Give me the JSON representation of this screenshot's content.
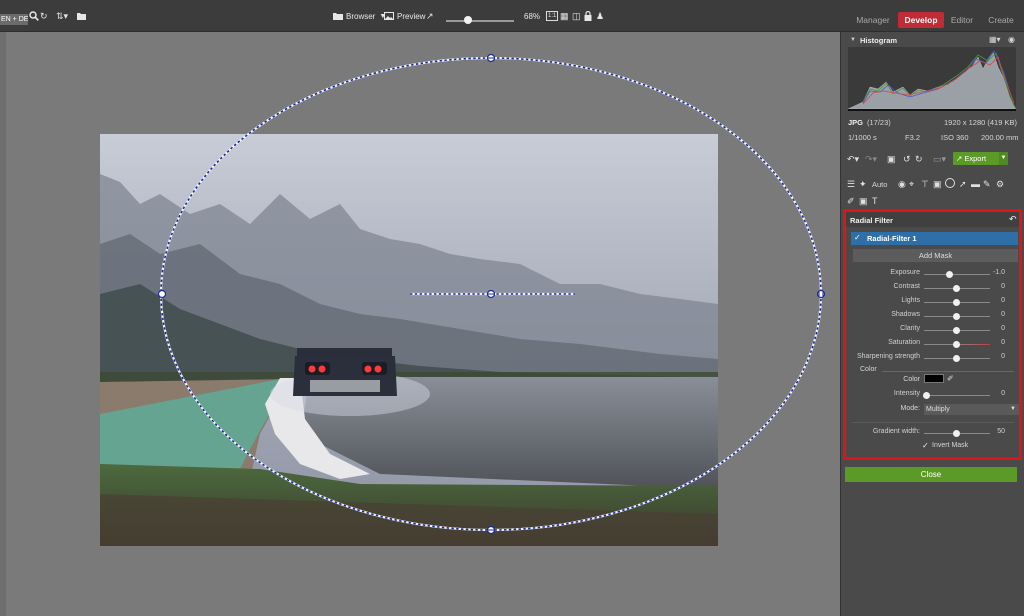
{
  "topbar": {
    "language": "EN + DE",
    "browser_label": "Browser",
    "preview_label": "Preview",
    "zoom": "68%",
    "zoom_fraction": 0.3
  },
  "tabs": [
    {
      "label": "Manager",
      "active": false
    },
    {
      "label": "Develop",
      "active": true
    },
    {
      "label": "Editor",
      "active": false
    },
    {
      "label": "Create",
      "active": false
    }
  ],
  "histogram": {
    "title": "Histogram",
    "format": "JPG",
    "index": "(17/23)",
    "dimensions": "1920 x 1280 (419 KB)",
    "shutter": "1/1000 s",
    "aperture": "F3.2",
    "iso": "ISO 360",
    "focal": "200.00 mm"
  },
  "toolbar": {
    "export_label": "Export",
    "auto_label": "Auto"
  },
  "radial_filter": {
    "title": "Radial Filter",
    "item_label": "Radial-Filter 1",
    "add_mask_label": "Add Mask",
    "sliders": [
      {
        "label": "Exposure",
        "value": "-1.0",
        "position": 0.4
      },
      {
        "label": "Contrast",
        "value": "0",
        "position": 0.5
      },
      {
        "label": "Lights",
        "value": "0",
        "position": 0.5
      },
      {
        "label": "Shadows",
        "value": "0",
        "position": 0.5
      },
      {
        "label": "Clarity",
        "value": "0",
        "position": 0.5
      },
      {
        "label": "Saturation",
        "value": "0",
        "position": 0.5
      },
      {
        "label": "Sharpening strength",
        "value": "0",
        "position": 0.5
      }
    ],
    "color_section_label": "Color",
    "color_label": "Color",
    "color_value": "#000000",
    "intensity_label": "Intensity",
    "intensity_value": "0",
    "intensity_position": 0.0,
    "mode_label": "Mode:",
    "mode_value": "Multiply",
    "gradient_label": "Gradient width:",
    "gradient_value": "50",
    "gradient_position": 0.5,
    "invert_label": "Invert Mask",
    "invert_checked": true
  },
  "close_label": "Close",
  "colors": {
    "accent_red": "#c02b35",
    "accent_green": "#5b9a27",
    "selection_blue": "#2f6fa8",
    "highlight_red": "#e01414",
    "ellipse_blue": "#1a2a9a"
  }
}
